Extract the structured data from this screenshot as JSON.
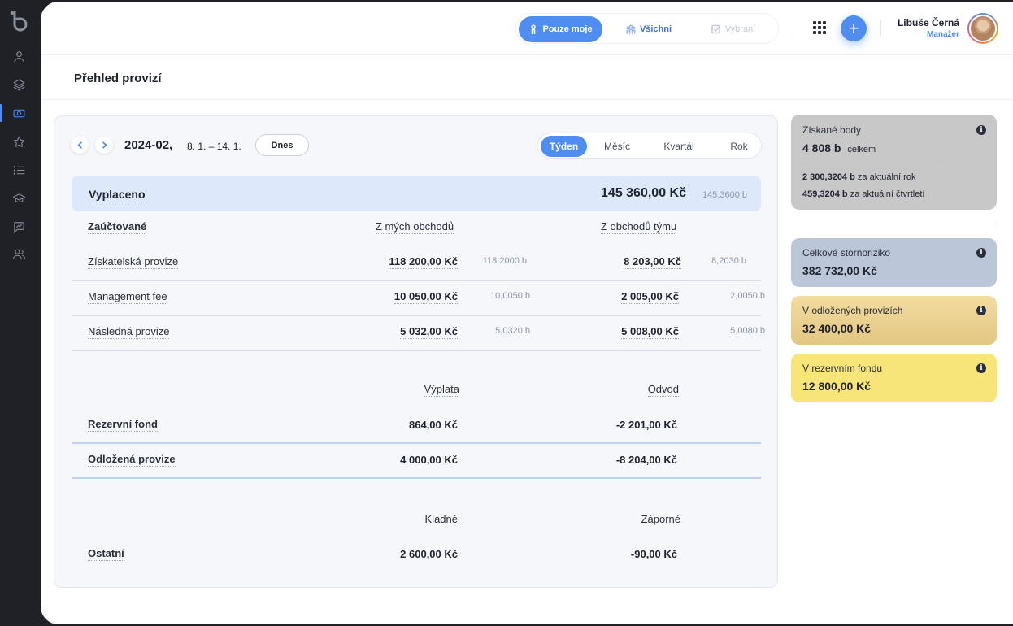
{
  "topbar": {
    "filters": [
      {
        "label": "Pouze moje",
        "active": true
      },
      {
        "label": "Všichni",
        "active": false
      },
      {
        "label": "Vybraní",
        "active": false,
        "disabled": true
      }
    ],
    "user": {
      "name": "Libuše Černá",
      "role": "Manažer"
    }
  },
  "page": {
    "title": "Přehled provizí"
  },
  "period": {
    "main": "2024-02,",
    "range": "8. 1. – 14. 1.",
    "today_label": "Dnes"
  },
  "ranges": [
    {
      "label": "Týden",
      "active": true
    },
    {
      "label": "Měsíc",
      "active": false
    },
    {
      "label": "Kvartál",
      "active": false
    },
    {
      "label": "Rok",
      "active": false
    }
  ],
  "paid": {
    "label": "Vyplaceno",
    "amount": "145 360,00 Kč",
    "points": "145,3600 b"
  },
  "accounted": {
    "label": "Zaúčtované",
    "col_own": "Z mých obchodů",
    "col_team": "Z obchodů týmu",
    "rows": [
      {
        "label": "Získatelská provize",
        "own": "118 200,00 Kč",
        "own_pts": "118,2000 b",
        "team": "8 203,00 Kč",
        "team_pts": "8,2030 b"
      },
      {
        "label": "Management fee",
        "own": "10 050,00 Kč",
        "own_pts": "10,0050 b",
        "team": "2 005,00 Kč",
        "team_pts": "2,0050 b"
      },
      {
        "label": "Následná provize",
        "own": "5 032,00 Kč",
        "own_pts": "5,0320 b",
        "team": "5 008,00 Kč",
        "team_pts": "5,0080 b"
      }
    ]
  },
  "funds": {
    "col_payout": "Výplata",
    "col_levy": "Odvod",
    "rows": [
      {
        "label": "Rezervní fond",
        "payout": "864,00 Kč",
        "levy": "-2 201,00 Kč"
      },
      {
        "label": "Odložená provize",
        "payout": "4 000,00 Kč",
        "levy": "-8 204,00 Kč"
      }
    ]
  },
  "other": {
    "col_pos": "Kladné",
    "col_neg": "Záporné",
    "label": "Ostatní",
    "pos": "2 600,00 Kč",
    "neg": "-90,00 Kč"
  },
  "widgets": {
    "points": {
      "title": "Získané body",
      "total": "4 808 b",
      "total_suffix": "celkem",
      "year_val": "2 300,3204 b",
      "year_label": "za aktuální rok",
      "quarter_val": "459,3204 b",
      "quarter_label": "za aktuální čtvrtletí",
      "color": "#c8c8c8"
    },
    "storno": {
      "title": "Celkové stornoriziko",
      "value": "382 732,00 Kč",
      "color": "#bcc6d9"
    },
    "deferred": {
      "title": "V odložených provizích",
      "value": "32 400,00 Kč",
      "color": "#ecd496"
    },
    "reserve": {
      "title": "V rezervním fondu",
      "value": "12 800,00 Kč",
      "color": "#f8e57a"
    }
  },
  "colors": {
    "accent": "#4f8ef0",
    "sidebar": "#1f2127"
  }
}
